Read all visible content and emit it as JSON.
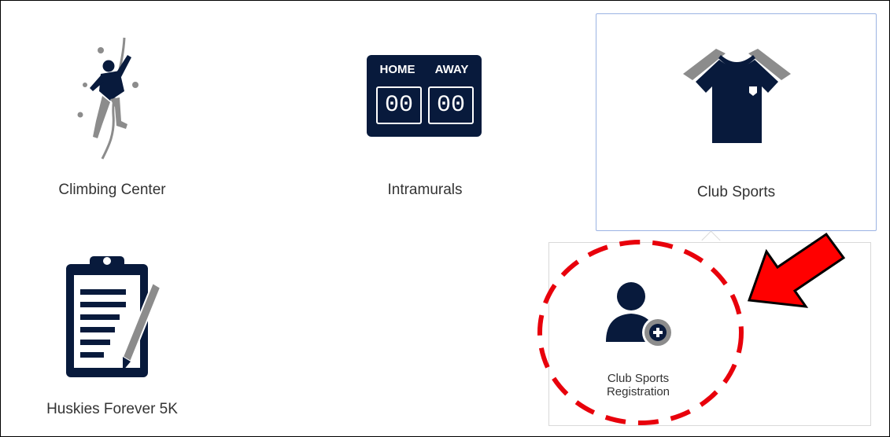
{
  "tiles": {
    "climbing": {
      "label": "Climbing Center",
      "icon": "climber-icon"
    },
    "intramurals": {
      "label": "Intramurals",
      "icon": "scoreboard-icon",
      "scoreboard": {
        "home": "HOME",
        "away": "AWAY",
        "home_score": "00",
        "away_score": "00"
      }
    },
    "club_sports": {
      "label": "Club Sports",
      "icon": "jersey-icon",
      "selected": true
    },
    "huskies_5k": {
      "label": "Huskies Forever 5K",
      "icon": "clipboard-icon"
    }
  },
  "submenu": {
    "items": [
      {
        "label": "Club Sports Registration",
        "icon": "add-user-icon"
      }
    ]
  },
  "annotations": {
    "highlight_color": "#e8000b",
    "arrow_color": "#ff0000"
  },
  "colors": {
    "icon_navy": "#081a3c",
    "icon_gray": "#8c8c8c",
    "selected_border": "#9bb3e3"
  }
}
